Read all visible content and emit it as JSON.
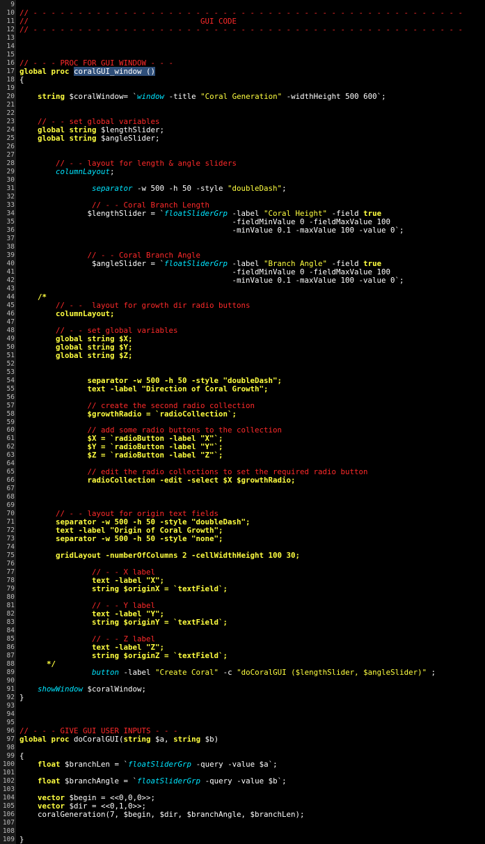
{
  "colors": {
    "background": "#000000",
    "gutter": "#1a1a1a",
    "line_number": "#bbbbbb",
    "comment": "#ff2a2a",
    "keyword": "#ffff40",
    "string": "#ffff40",
    "function": "#00e5ff",
    "plain": "#ffffff",
    "selection": "#2f4f7a"
  },
  "lines": [
    {
      "n": "9",
      "s": []
    },
    {
      "n": "10",
      "s": [
        {
          "t": "// - - - - - - - - - - - - - - - - - - - - - - - - - - - - - - - - - - - - - - - - - - - - - - - -",
          "c": "c"
        }
      ]
    },
    {
      "n": "11",
      "s": [
        {
          "t": "//                                      GUI CODE",
          "c": "c"
        }
      ]
    },
    {
      "n": "12",
      "s": [
        {
          "t": "// - - - - - - - - - - - - - - - - - - - - - - - - - - - - - - - - - - - - - - - - - - - - - - - -",
          "c": "c"
        }
      ]
    },
    {
      "n": "13",
      "s": []
    },
    {
      "n": "14",
      "s": []
    },
    {
      "n": "15",
      "s": []
    },
    {
      "n": "16",
      "s": [
        {
          "t": "// - - - PROC FOR GUI WINDOW - - -",
          "c": "c"
        }
      ]
    },
    {
      "n": "17",
      "s": [
        {
          "t": "global proc",
          "c": "k"
        },
        {
          "t": " ",
          "c": "p"
        },
        {
          "t": "coralGUI_window ()",
          "c": "p",
          "sel": true
        }
      ]
    },
    {
      "n": "18",
      "s": [
        {
          "t": "{",
          "c": "p"
        }
      ]
    },
    {
      "n": "19",
      "s": []
    },
    {
      "n": "20",
      "s": [
        {
          "t": "    ",
          "c": "p"
        },
        {
          "t": "string",
          "c": "k"
        },
        {
          "t": " $coralWindow= `",
          "c": "p"
        },
        {
          "t": "window",
          "c": "f"
        },
        {
          "t": " -title ",
          "c": "p"
        },
        {
          "t": "\"Coral Generation\"",
          "c": "s"
        },
        {
          "t": " -widthHeight 500 600`;",
          "c": "p"
        }
      ]
    },
    {
      "n": "21",
      "s": []
    },
    {
      "n": "22",
      "s": []
    },
    {
      "n": "23",
      "s": [
        {
          "t": "    // - - set global variables",
          "c": "c"
        }
      ]
    },
    {
      "n": "24",
      "s": [
        {
          "t": "    ",
          "c": "p"
        },
        {
          "t": "global string",
          "c": "k"
        },
        {
          "t": " $lengthSlider;",
          "c": "p"
        }
      ]
    },
    {
      "n": "25",
      "s": [
        {
          "t": "    ",
          "c": "p"
        },
        {
          "t": "global string",
          "c": "k"
        },
        {
          "t": " $angleSlider;",
          "c": "p"
        }
      ]
    },
    {
      "n": "26",
      "s": []
    },
    {
      "n": "27",
      "s": []
    },
    {
      "n": "28",
      "s": [
        {
          "t": "        // - - layout for length & angle sliders",
          "c": "c"
        }
      ]
    },
    {
      "n": "29",
      "s": [
        {
          "t": "        ",
          "c": "p"
        },
        {
          "t": "columnLayout",
          "c": "f"
        },
        {
          "t": ";",
          "c": "p"
        }
      ]
    },
    {
      "n": "30",
      "s": []
    },
    {
      "n": "31",
      "s": [
        {
          "t": "                ",
          "c": "p"
        },
        {
          "t": "separator",
          "c": "f"
        },
        {
          "t": " -w 500 -h 50 -style ",
          "c": "p"
        },
        {
          "t": "\"doubleDash\"",
          "c": "s"
        },
        {
          "t": ";",
          "c": "p"
        }
      ]
    },
    {
      "n": "32",
      "s": []
    },
    {
      "n": "33",
      "s": [
        {
          "t": "                // - - Coral Branch Length",
          "c": "c"
        }
      ]
    },
    {
      "n": "34",
      "s": [
        {
          "t": "               $lengthSlider = `",
          "c": "p"
        },
        {
          "t": "floatSliderGrp",
          "c": "f"
        },
        {
          "t": " -label ",
          "c": "p"
        },
        {
          "t": "\"Coral Height\"",
          "c": "s"
        },
        {
          "t": " -field ",
          "c": "p"
        },
        {
          "t": "true",
          "c": "k"
        }
      ]
    },
    {
      "n": "35",
      "s": [
        {
          "t": "                                               -fieldMinValue 0 -fieldMaxValue 100",
          "c": "p"
        }
      ]
    },
    {
      "n": "36",
      "s": [
        {
          "t": "                                               -minValue 0.1 -maxValue 100 -value 0`;",
          "c": "p"
        }
      ]
    },
    {
      "n": "37",
      "s": []
    },
    {
      "n": "38",
      "s": []
    },
    {
      "n": "39",
      "s": [
        {
          "t": "               // - - Coral Branch Angle",
          "c": "c"
        }
      ]
    },
    {
      "n": "40",
      "s": [
        {
          "t": "                $angleSlider = `",
          "c": "p"
        },
        {
          "t": "floatSliderGrp",
          "c": "f"
        },
        {
          "t": " -label ",
          "c": "p"
        },
        {
          "t": "\"Branch Angle\"",
          "c": "s"
        },
        {
          "t": " -field ",
          "c": "p"
        },
        {
          "t": "true",
          "c": "k"
        }
      ]
    },
    {
      "n": "41",
      "s": [
        {
          "t": "                                               -fieldMinValue 0 -fieldMaxValue 100",
          "c": "p"
        }
      ]
    },
    {
      "n": "42",
      "s": [
        {
          "t": "                                               -minValue 0.1 -maxValue 100 -value 0`;",
          "c": "p"
        }
      ]
    },
    {
      "n": "43",
      "s": []
    },
    {
      "n": "44",
      "s": [
        {
          "t": "    /*",
          "c": "k"
        }
      ]
    },
    {
      "n": "45",
      "s": [
        {
          "t": "        // - -  layout for growth dir radio buttons",
          "c": "c"
        }
      ]
    },
    {
      "n": "46",
      "s": [
        {
          "t": "        columnLayout;",
          "c": "k"
        }
      ]
    },
    {
      "n": "47",
      "s": []
    },
    {
      "n": "48",
      "s": [
        {
          "t": "        // - - set global variables",
          "c": "c"
        }
      ]
    },
    {
      "n": "49",
      "s": [
        {
          "t": "        global string $X;",
          "c": "k"
        }
      ]
    },
    {
      "n": "50",
      "s": [
        {
          "t": "        global string $Y;",
          "c": "k"
        }
      ]
    },
    {
      "n": "51",
      "s": [
        {
          "t": "        global string $Z;",
          "c": "k"
        }
      ]
    },
    {
      "n": "52",
      "s": []
    },
    {
      "n": "53",
      "s": []
    },
    {
      "n": "54",
      "s": [
        {
          "t": "               separator -w 500 -h 50 -style \"doubleDash\";",
          "c": "k"
        }
      ]
    },
    {
      "n": "55",
      "s": [
        {
          "t": "               text -label \"Direction of Coral Growth\";",
          "c": "k"
        }
      ]
    },
    {
      "n": "56",
      "s": []
    },
    {
      "n": "57",
      "s": [
        {
          "t": "               // create the second radio collection",
          "c": "c"
        }
      ]
    },
    {
      "n": "58",
      "s": [
        {
          "t": "               $growthRadio = `radioCollection`;",
          "c": "k"
        }
      ]
    },
    {
      "n": "59",
      "s": []
    },
    {
      "n": "60",
      "s": [
        {
          "t": "               // add some radio buttons to the collection",
          "c": "c"
        }
      ]
    },
    {
      "n": "61",
      "s": [
        {
          "t": "               $X = `radioButton -label \"X\"`;",
          "c": "k"
        }
      ]
    },
    {
      "n": "62",
      "s": [
        {
          "t": "               $Y = `radioButton -label \"Y\"`;",
          "c": "k"
        }
      ]
    },
    {
      "n": "63",
      "s": [
        {
          "t": "               $Z = `radioButton -label \"Z\"`;",
          "c": "k"
        }
      ]
    },
    {
      "n": "64",
      "s": []
    },
    {
      "n": "65",
      "s": [
        {
          "t": "               // edit the radio collections to set the required radio button",
          "c": "c"
        }
      ]
    },
    {
      "n": "66",
      "s": [
        {
          "t": "               radioCollection -edit -select $X $growthRadio;",
          "c": "k"
        }
      ]
    },
    {
      "n": "67",
      "s": []
    },
    {
      "n": "68",
      "s": []
    },
    {
      "n": "69",
      "s": []
    },
    {
      "n": "70",
      "s": [
        {
          "t": "        // - - layout for origin text fields",
          "c": "c"
        }
      ]
    },
    {
      "n": "71",
      "s": [
        {
          "t": "        separator -w 500 -h 50 -style \"doubleDash\";",
          "c": "k"
        }
      ]
    },
    {
      "n": "72",
      "s": [
        {
          "t": "        text -label \"Origin of Coral Growth\";",
          "c": "k"
        }
      ]
    },
    {
      "n": "73",
      "s": [
        {
          "t": "        separator -w 500 -h 50 -style \"none\";",
          "c": "k"
        }
      ]
    },
    {
      "n": "74",
      "s": []
    },
    {
      "n": "75",
      "s": [
        {
          "t": "        gridLayout -numberOfColumns 2 -cellWidthHeight 100 30;",
          "c": "k"
        }
      ]
    },
    {
      "n": "76",
      "s": []
    },
    {
      "n": "77",
      "s": [
        {
          "t": "                // - - X label",
          "c": "c"
        }
      ]
    },
    {
      "n": "78",
      "s": [
        {
          "t": "                text -label \"X\";",
          "c": "k"
        }
      ]
    },
    {
      "n": "79",
      "s": [
        {
          "t": "                string $originX = `textField`;",
          "c": "k"
        }
      ]
    },
    {
      "n": "80",
      "s": []
    },
    {
      "n": "81",
      "s": [
        {
          "t": "                // - - Y label",
          "c": "c"
        }
      ]
    },
    {
      "n": "82",
      "s": [
        {
          "t": "                text -label \"Y\";",
          "c": "k"
        }
      ]
    },
    {
      "n": "83",
      "s": [
        {
          "t": "                string $originY = `textField`;",
          "c": "k"
        }
      ]
    },
    {
      "n": "84",
      "s": []
    },
    {
      "n": "85",
      "s": [
        {
          "t": "                // - - Z label",
          "c": "c"
        }
      ]
    },
    {
      "n": "86",
      "s": [
        {
          "t": "                text -label \"Z\";",
          "c": "k"
        }
      ]
    },
    {
      "n": "87",
      "s": [
        {
          "t": "                string $originZ = `textField`;",
          "c": "k"
        }
      ]
    },
    {
      "n": "88",
      "s": [
        {
          "t": "      */",
          "c": "k"
        }
      ]
    },
    {
      "n": "89",
      "s": [
        {
          "t": "                ",
          "c": "p"
        },
        {
          "t": "button",
          "c": "f"
        },
        {
          "t": " -label ",
          "c": "p"
        },
        {
          "t": "\"Create Coral\"",
          "c": "s"
        },
        {
          "t": " -c ",
          "c": "p"
        },
        {
          "t": "\"doCoralGUI ($lengthSlider, $angleSlider)\"",
          "c": "s"
        },
        {
          "t": " ;",
          "c": "p"
        }
      ]
    },
    {
      "n": "90",
      "s": []
    },
    {
      "n": "91",
      "s": [
        {
          "t": "    ",
          "c": "p"
        },
        {
          "t": "showWindow",
          "c": "f"
        },
        {
          "t": " $coralWindow;",
          "c": "p"
        }
      ]
    },
    {
      "n": "92",
      "s": [
        {
          "t": "}",
          "c": "p"
        }
      ]
    },
    {
      "n": "93",
      "s": []
    },
    {
      "n": "94",
      "s": []
    },
    {
      "n": "95",
      "s": []
    },
    {
      "n": "96",
      "s": [
        {
          "t": "// - - - GIVE GUI USER INPUTS - - -",
          "c": "c"
        }
      ]
    },
    {
      "n": "97",
      "s": [
        {
          "t": "global proc",
          "c": "k"
        },
        {
          "t": " doCoralGUI(",
          "c": "p"
        },
        {
          "t": "string",
          "c": "k"
        },
        {
          "t": " $a, ",
          "c": "p"
        },
        {
          "t": "string",
          "c": "k"
        },
        {
          "t": " $b)",
          "c": "p"
        }
      ]
    },
    {
      "n": "98",
      "s": []
    },
    {
      "n": "99",
      "s": [
        {
          "t": "{",
          "c": "p"
        }
      ]
    },
    {
      "n": "100",
      "s": [
        {
          "t": "    ",
          "c": "p"
        },
        {
          "t": "float",
          "c": "k"
        },
        {
          "t": " $branchLen = `",
          "c": "p"
        },
        {
          "t": "floatSliderGrp",
          "c": "f"
        },
        {
          "t": " -query -value $a`;",
          "c": "p"
        }
      ]
    },
    {
      "n": "101",
      "s": []
    },
    {
      "n": "102",
      "s": [
        {
          "t": "    ",
          "c": "p"
        },
        {
          "t": "float",
          "c": "k"
        },
        {
          "t": " $branchAngle = `",
          "c": "p"
        },
        {
          "t": "floatSliderGrp",
          "c": "f"
        },
        {
          "t": " -query -value $b`;",
          "c": "p"
        }
      ]
    },
    {
      "n": "103",
      "s": []
    },
    {
      "n": "104",
      "s": [
        {
          "t": "    ",
          "c": "p"
        },
        {
          "t": "vector",
          "c": "k"
        },
        {
          "t": " $begin = <<0,0,0>>;",
          "c": "p"
        }
      ]
    },
    {
      "n": "105",
      "s": [
        {
          "t": "    ",
          "c": "p"
        },
        {
          "t": "vector",
          "c": "k"
        },
        {
          "t": " $dir = <<0,1,0>>;",
          "c": "p"
        }
      ]
    },
    {
      "n": "106",
      "s": [
        {
          "t": "    coralGeneration(7, $begin, $dir, $branchAngle, $branchLen);",
          "c": "p"
        }
      ]
    },
    {
      "n": "107",
      "s": []
    },
    {
      "n": "108",
      "s": []
    },
    {
      "n": "109",
      "s": [
        {
          "t": "}",
          "c": "p"
        }
      ]
    }
  ]
}
